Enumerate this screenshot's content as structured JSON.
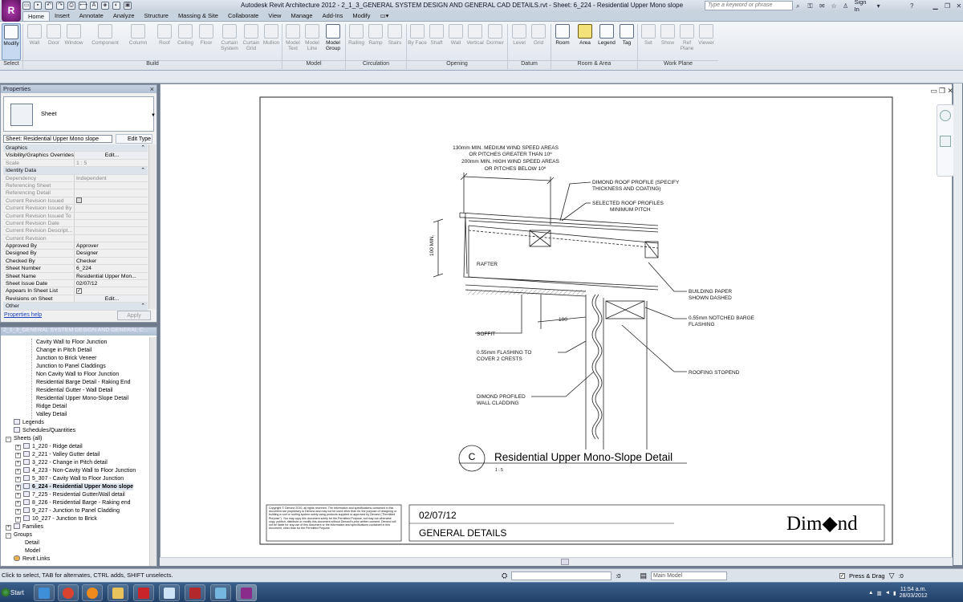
{
  "app": {
    "window_title": "Autodesk Revit Architecture 2012 -    2_1_3_GENERAL SYSTEM DESIGN AND GENERAL CAD DETAILS.rvt - Sheet: 6_224 - Residential Upper Mono slope",
    "search_placeholder": "Type a keyword or phrase",
    "sign_in": "Sign In",
    "help": "?"
  },
  "ribbon": {
    "tabs": [
      "Home",
      "Insert",
      "Annotate",
      "Analyze",
      "Structure",
      "Massing & Site",
      "Collaborate",
      "View",
      "Manage",
      "Add-Ins",
      "Modify"
    ],
    "active_tab": "Home",
    "tools": {
      "modify": "Modify",
      "wall": "Wall",
      "door": "Door",
      "window": "Window",
      "component": "Component",
      "column": "Column",
      "roof": "Roof",
      "ceiling": "Ceiling",
      "floor": "Floor",
      "curtain_system": "Curtain System",
      "curtain_grid": "Curtain Grid",
      "mullion": "Mullion",
      "model_text": "Model Text",
      "model_line": "Model Line",
      "model_group": "Model Group",
      "railing": "Railing",
      "ramp": "Ramp",
      "stairs": "Stairs",
      "by_face": "By Face",
      "shaft": "Shaft",
      "wall_opening": "Wall",
      "vertical": "Vertical",
      "dormer": "Dormer",
      "level": "Level",
      "grid": "Grid",
      "room": "Room",
      "area": "Area",
      "legend": "Legend",
      "tag": "Tag",
      "set": "Set",
      "show": "Show",
      "ref_plane": "Ref Plane",
      "viewer": "Viewer"
    },
    "groups": {
      "select": "Select",
      "build": "Build",
      "model": "Model",
      "circulation": "Circulation",
      "opening": "Opening",
      "datum": "Datum",
      "room_area": "Room & Area",
      "work_plane": "Work Plane"
    }
  },
  "properties": {
    "title": "Properties",
    "type_name": "Sheet",
    "instance_selector": "Sheet: Residential Upper Mono slope",
    "edit_type": "Edit Type",
    "rows": [
      {
        "kind": "cat",
        "name": "Graphics"
      },
      {
        "name": "Visibility/Graphics Overrides",
        "value": "Edit...",
        "button": true
      },
      {
        "name": "Scale",
        "value": "1 : 5",
        "grey": true
      },
      {
        "kind": "cat",
        "name": "Identity Data"
      },
      {
        "name": "Dependency",
        "value": "Independent",
        "grey": true
      },
      {
        "name": "Referencing Sheet",
        "value": "",
        "grey": true
      },
      {
        "name": "Referencing Detail",
        "value": "",
        "grey": true
      },
      {
        "name": "Current Revision Issued",
        "value": "",
        "grey": true,
        "check": false
      },
      {
        "name": "Current Revision Issued By",
        "value": "",
        "grey": true
      },
      {
        "name": "Current Revision Issued To",
        "value": "",
        "grey": true
      },
      {
        "name": "Current Revision Date",
        "value": "",
        "grey": true
      },
      {
        "name": "Current Revision Descript...",
        "value": "",
        "grey": true
      },
      {
        "name": "Current Revision",
        "value": "",
        "grey": true
      },
      {
        "name": "Approved By",
        "value": "Approver"
      },
      {
        "name": "Designed By",
        "value": "Designer"
      },
      {
        "name": "Checked By",
        "value": "Checker"
      },
      {
        "name": "Sheet Number",
        "value": "6_224"
      },
      {
        "name": "Sheet Name",
        "value": "Residential Upper Mon..."
      },
      {
        "name": "Sheet Issue Date",
        "value": "02/07/12"
      },
      {
        "name": "Appears In Sheet List",
        "value": "",
        "check": true
      },
      {
        "name": "Revisions on Sheet",
        "value": "Edit...",
        "button": true
      },
      {
        "kind": "cat",
        "name": "Other"
      }
    ],
    "help_link": "Properties help",
    "apply": "Apply"
  },
  "browser": {
    "title": "2_1_3_GENERAL SYSTEM DESIGN AND GENERAL C...",
    "items": [
      {
        "label": "Cavity Wall to Floor Junction",
        "indent": 44,
        "type": "view"
      },
      {
        "label": "Change in Pitch Detail",
        "indent": 44,
        "type": "view"
      },
      {
        "label": "Junction to Brick Veneer",
        "indent": 44,
        "type": "view"
      },
      {
        "label": "Junction to Panel Claddings",
        "indent": 44,
        "type": "view"
      },
      {
        "label": "Non Cavity Wall to Floor Junction",
        "indent": 44,
        "type": "view"
      },
      {
        "label": "Residential Barge Detail - Raking End",
        "indent": 44,
        "type": "view"
      },
      {
        "label": "Residential Gutter - Wall Detail",
        "indent": 44,
        "type": "view"
      },
      {
        "label": "Residential Upper Mono-Slope Detail",
        "indent": 44,
        "type": "view"
      },
      {
        "label": "Ridge Detail",
        "indent": 44,
        "type": "view"
      },
      {
        "label": "Valley Detail",
        "indent": 44,
        "type": "view"
      },
      {
        "label": "Legends",
        "indent": 16,
        "type": "cat"
      },
      {
        "label": "Schedules/Quantities",
        "indent": 16,
        "type": "cat"
      },
      {
        "label": "Sheets (all)",
        "indent": 6,
        "type": "open"
      },
      {
        "label": "1_220 - Ridge detail",
        "indent": 18,
        "type": "plus"
      },
      {
        "label": "2_221 - Valley Gutter detail",
        "indent": 18,
        "type": "plus"
      },
      {
        "label": "3_222 - Change in Pitch detail",
        "indent": 18,
        "type": "plus"
      },
      {
        "label": "4_223 - Non-Cavity Wall to Floor Junction",
        "indent": 18,
        "type": "plus"
      },
      {
        "label": "5_307 - Cavity Wall to Floor Junction",
        "indent": 18,
        "type": "plus"
      },
      {
        "label": "6_224 - Residential Upper Mono slope",
        "indent": 18,
        "type": "plus",
        "bold": true
      },
      {
        "label": "7_225 - Residential Gutter/Wall detail",
        "indent": 18,
        "type": "plus"
      },
      {
        "label": "8_226 - Residential Barge - Raking end",
        "indent": 18,
        "type": "plus"
      },
      {
        "label": "9_227 - Junction to Panel Cladding",
        "indent": 18,
        "type": "plus"
      },
      {
        "label": "10_227 - Junction to Brick",
        "indent": 18,
        "type": "plus"
      },
      {
        "label": "Families",
        "indent": 6,
        "type": "plus"
      },
      {
        "label": "Groups",
        "indent": 6,
        "type": "open"
      },
      {
        "label": "Detail",
        "indent": 30,
        "type": "none"
      },
      {
        "label": "Model",
        "indent": 30,
        "type": "none"
      },
      {
        "label": "Revit Links",
        "indent": 16,
        "type": "link"
      }
    ]
  },
  "drawing": {
    "annotations": {
      "wind1": "130mm MIN. MEDIUM WIND SPEED AREAS",
      "wind2": "OR PITCHES GREATER THAN 10º",
      "wind3": "200mm MIN. HIGH WIND SPEED AREAS",
      "wind4": "OR PITCHES BELOW 10º",
      "profile1": "DIMOND ROOF PROFILE (SPECIFY",
      "profile2": "THICKNESS AND COATING)",
      "selected1": "SELECTED ROOF PROFILES",
      "selected2": "MINIMUM PITCH",
      "min100": "100 MIN.",
      "rafter": "RAFTER",
      "paper1": "BUILDING PAPER",
      "paper2": "SHOWN DASHED",
      "dim100": "100",
      "barge1": "0.55mm NOTCHED BARGE",
      "barge2": "FLASHING",
      "soffit": "SOFFIT",
      "flash1": "0.55mm FLASHING TO",
      "flash2": "COVER 2 CRESTS",
      "stopend": "ROOFING STOPEND",
      "clad1": "DIMOND PROFILED",
      "clad2": "WALL CLADDING"
    },
    "detail_letter": "C",
    "detail_title": "Residential Upper Mono-Slope Detail",
    "detail_scale": "1 : 5",
    "copyright": "Copyright © Dimond 2010, all rights reserved. The information and specifications contained in this document are proprietary to Dimond and may not be used other than for the purpose of designing or building a roof or roofing system solely using products supplied or approved by Dimond (\"Permitted Purpose\"). You may copy this document solely for the Permitted Purpose, but may not otherwise copy, publish, distribute or modify this document without Dimond's prior written consent. Dimond will not be liable for any use of this document or the information and specifications contained in this document, other than for the Permitted Purpose.",
    "date": "02/07/12",
    "section": "GENERAL DETAILS",
    "logo": "Dim◆nd"
  },
  "status": {
    "text": "Click to select, TAB for alternates, CTRL adds, SHIFT unselects.",
    "zero1": ":0",
    "model_combo": "Main Model",
    "press_drag": "Press & Drag",
    "zero2": ":0"
  },
  "taskbar": {
    "start": "Start",
    "time": "11:54 a.m.",
    "date": "28/03/2012"
  }
}
